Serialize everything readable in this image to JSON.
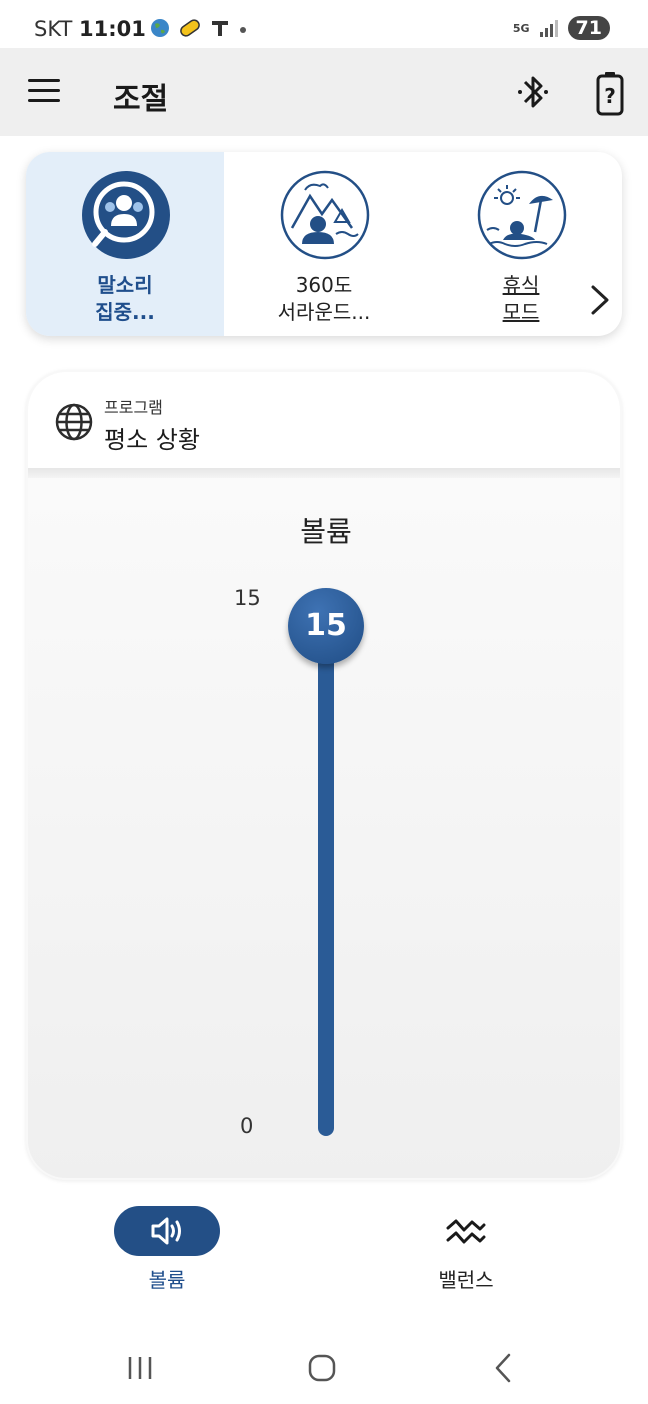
{
  "status": {
    "carrier": "SKT",
    "time": "11:01",
    "network": "5G",
    "battery": "71"
  },
  "appbar": {
    "title": "조절"
  },
  "modes": [
    {
      "line1": "말소리",
      "line2": "집중...",
      "icon": "focus-speech-icon",
      "active": true
    },
    {
      "line1": "360도",
      "line2": "서라운드...",
      "icon": "mountain-surround-icon",
      "active": false
    },
    {
      "line1": "휴식",
      "line2": "모드",
      "icon": "beach-rest-icon",
      "active": false
    }
  ],
  "program": {
    "label": "프로그램",
    "name": "평소 상황"
  },
  "volume": {
    "title": "볼륨",
    "max_label": "15",
    "min_label": "0",
    "value": "15"
  },
  "tabs": {
    "volume": "볼륨",
    "balance": "밸런스"
  },
  "colors": {
    "accent": "#234f86",
    "active_tile": "#e3eef9",
    "appbar_bg": "#efefef"
  }
}
